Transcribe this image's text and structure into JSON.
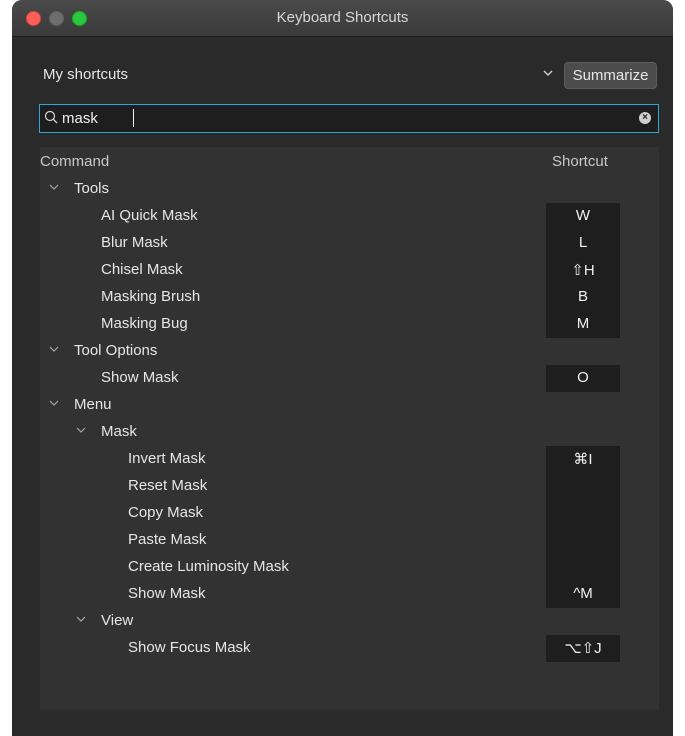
{
  "window": {
    "title": "Keyboard Shortcuts"
  },
  "toolbar": {
    "preset_value": "My shortcuts",
    "summarize_label": "Summarize"
  },
  "search": {
    "value": "mask"
  },
  "table": {
    "headers": {
      "command": "Command",
      "shortcut": "Shortcut"
    },
    "rows": [
      {
        "label": "Tools",
        "level": 0,
        "group": true,
        "shortcut": ""
      },
      {
        "label": "AI Quick Mask",
        "level": 1,
        "group": false,
        "shortcut": "W"
      },
      {
        "label": "Blur Mask",
        "level": 1,
        "group": false,
        "shortcut": "L"
      },
      {
        "label": "Chisel Mask",
        "level": 1,
        "group": false,
        "shortcut": "⇧H"
      },
      {
        "label": "Masking Brush",
        "level": 1,
        "group": false,
        "shortcut": "B"
      },
      {
        "label": "Masking Bug",
        "level": 1,
        "group": false,
        "shortcut": "M"
      },
      {
        "label": "Tool Options",
        "level": 0,
        "group": true,
        "shortcut": ""
      },
      {
        "label": "Show Mask",
        "level": 1,
        "group": false,
        "shortcut": "O"
      },
      {
        "label": "Menu",
        "level": 0,
        "group": true,
        "shortcut": ""
      },
      {
        "label": "Mask",
        "level": 1,
        "group": true,
        "shortcut": ""
      },
      {
        "label": "Invert Mask",
        "level": 2,
        "group": false,
        "shortcut": "⌘I"
      },
      {
        "label": "Reset Mask",
        "level": 2,
        "group": false,
        "shortcut": ""
      },
      {
        "label": "Copy Mask",
        "level": 2,
        "group": false,
        "shortcut": ""
      },
      {
        "label": "Paste Mask",
        "level": 2,
        "group": false,
        "shortcut": ""
      },
      {
        "label": "Create Luminosity Mask",
        "level": 2,
        "group": false,
        "shortcut": ""
      },
      {
        "label": "Show Mask",
        "level": 2,
        "group": false,
        "shortcut": "^M"
      },
      {
        "label": "View",
        "level": 1,
        "group": true,
        "shortcut": ""
      },
      {
        "label": "Show Focus Mask",
        "level": 2,
        "group": false,
        "shortcut": "⌥⇧J"
      }
    ]
  },
  "icons": {
    "chevron": "chevron-down-icon",
    "search": "search-icon",
    "clear": "clear-icon"
  },
  "colors": {
    "focus_ring": "#2ea7d6",
    "close": "#fe5f57",
    "zoom": "#29c840"
  }
}
